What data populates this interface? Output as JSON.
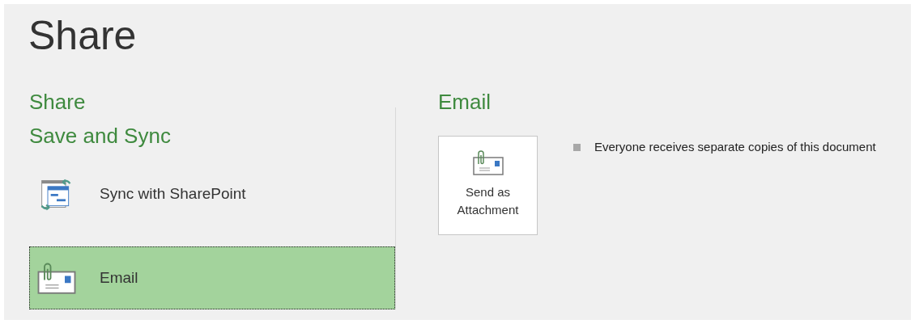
{
  "title": "Share",
  "left_pane": {
    "headings": [
      "Share",
      "Save and Sync"
    ],
    "items": [
      {
        "label": "Sync with SharePoint",
        "kind": "sync",
        "selected": false
      },
      {
        "label": "Email",
        "kind": "email",
        "selected": true
      }
    ]
  },
  "right_pane": {
    "heading": "Email",
    "action_button": {
      "label": "Send as Attachment"
    },
    "bullets": [
      "Everyone receives separate copies of this document"
    ]
  }
}
